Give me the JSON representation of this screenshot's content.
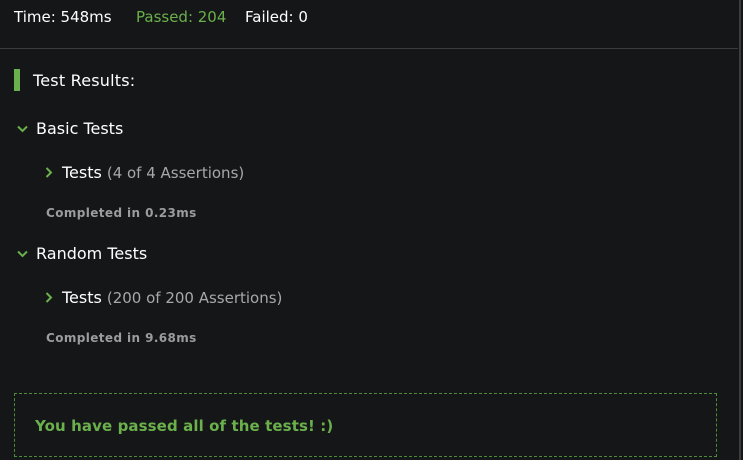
{
  "stats": {
    "time": "Time: 548ms",
    "passed": "Passed: 204",
    "failed": "Failed: 0"
  },
  "results_title": "Test Results:",
  "groups": [
    {
      "label": "Basic Tests",
      "tests_label": "Tests",
      "assertions": "(4 of 4 Assertions)",
      "completed": "Completed in 0.23ms"
    },
    {
      "label": "Random Tests",
      "tests_label": "Tests",
      "assertions": "(200 of 200 Assertions)",
      "completed": "Completed in 9.68ms"
    }
  ],
  "pass_message": "You have passed all of the tests! :)",
  "colors": {
    "background": "#151617",
    "success_green": "#6ab04c",
    "muted_text": "#a6a8aa"
  },
  "icons": {
    "group_toggle": "chevron-down-icon",
    "test_toggle": "chevron-right-icon",
    "header_marker": "status-bar-marker"
  }
}
